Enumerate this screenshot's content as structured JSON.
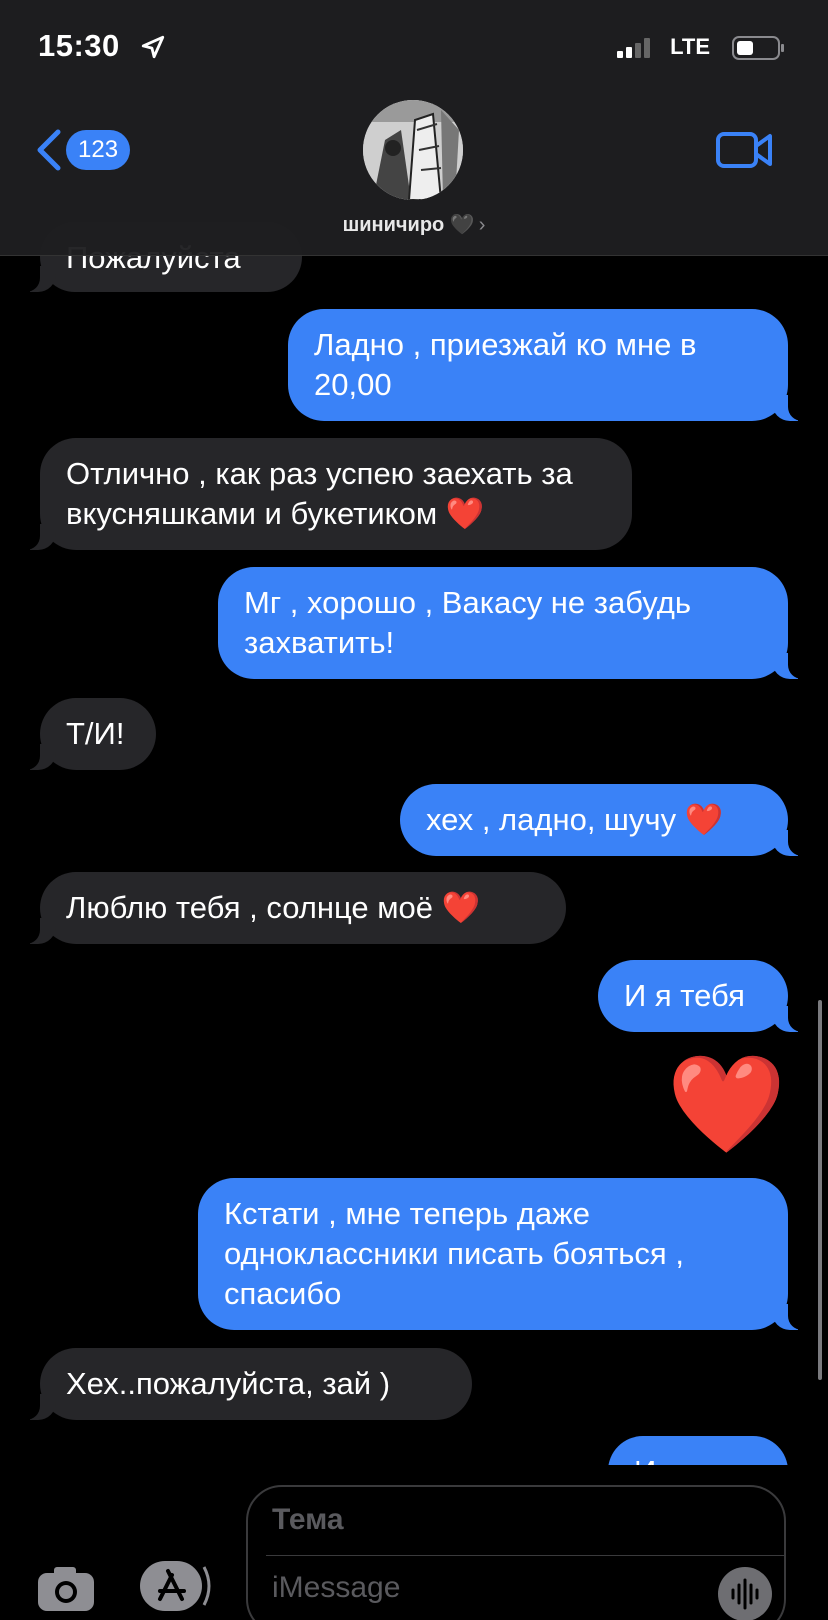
{
  "status_bar": {
    "time": "15:30",
    "network": "LTE"
  },
  "header": {
    "back_badge": "123",
    "contact_name": "шиничиро 🖤",
    "contact_arrow": "›"
  },
  "messages": [
    {
      "side": "in",
      "text": "Пожалуйста"
    },
    {
      "side": "out",
      "text": "Ладно , приезжай ко мне в 20,00"
    },
    {
      "side": "in",
      "text": "Отлично , как раз успею заехать за вкусняшками и букетиком",
      "emoji": "❤️"
    },
    {
      "side": "out",
      "text": "Мг , хорошо , Вакасу не забудь захватить!"
    },
    {
      "side": "in",
      "text": "Т/И!"
    },
    {
      "side": "out",
      "text": "хех , ладно, шучу",
      "emoji": "❤️"
    },
    {
      "side": "in",
      "text": "Люблю тебя , солнце моё",
      "emoji": "❤️"
    },
    {
      "side": "out",
      "text": "И я тебя"
    },
    {
      "side": "out",
      "text": "❤️"
    },
    {
      "side": "out",
      "text": "Кстати , мне теперь даже одноклассники писать бояться , спасибо"
    },
    {
      "side": "in",
      "text": "Хех..пожалуйста, зай )"
    },
    {
      "side": "out",
      "text": "Идиот"
    }
  ],
  "composer": {
    "subject_placeholder": "Тема",
    "message_placeholder": "iMessage"
  },
  "colors": {
    "outgoing": "#3a82f7",
    "incoming": "#262629",
    "accent": "#3a82f7"
  }
}
